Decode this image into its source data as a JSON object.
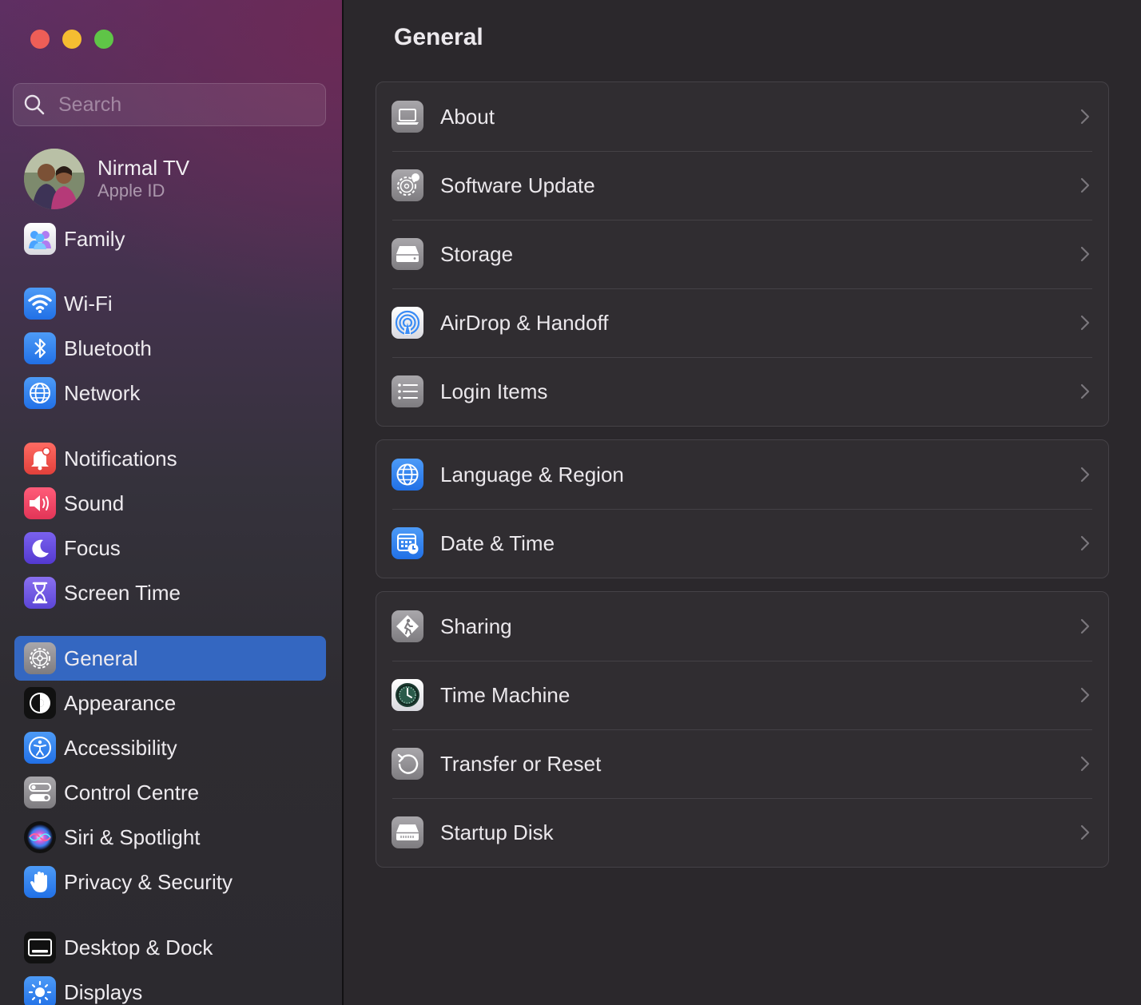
{
  "window": {
    "controls": [
      "close",
      "minimize",
      "zoom"
    ]
  },
  "search": {
    "placeholder": "Search"
  },
  "profile": {
    "name": "Nirmal TV",
    "subtitle": "Apple ID"
  },
  "sidebar": {
    "family": {
      "label": "Family",
      "icon": "family-icon"
    },
    "items": [
      {
        "label": "Wi-Fi",
        "icon": "wifi-icon"
      },
      {
        "label": "Bluetooth",
        "icon": "bluetooth-icon"
      },
      {
        "label": "Network",
        "icon": "globe-icon"
      },
      {
        "label": "Notifications",
        "icon": "bell-icon"
      },
      {
        "label": "Sound",
        "icon": "speaker-icon"
      },
      {
        "label": "Focus",
        "icon": "moon-icon"
      },
      {
        "label": "Screen Time",
        "icon": "hourglass-icon"
      },
      {
        "label": "General",
        "icon": "gear-icon",
        "selected": true
      },
      {
        "label": "Appearance",
        "icon": "appearance-icon"
      },
      {
        "label": "Accessibility",
        "icon": "accessibility-icon"
      },
      {
        "label": "Control Centre",
        "icon": "toggles-icon"
      },
      {
        "label": "Siri & Spotlight",
        "icon": "siri-icon"
      },
      {
        "label": "Privacy & Security",
        "icon": "hand-icon"
      },
      {
        "label": "Desktop & Dock",
        "icon": "dock-icon"
      },
      {
        "label": "Displays",
        "icon": "sun-icon"
      }
    ]
  },
  "main": {
    "title": "General",
    "groups": [
      [
        {
          "label": "About",
          "icon": "laptop-icon"
        },
        {
          "label": "Software Update",
          "icon": "gear-badge-icon"
        },
        {
          "label": "Storage",
          "icon": "drive-icon"
        },
        {
          "label": "AirDrop & Handoff",
          "icon": "airdrop-icon"
        },
        {
          "label": "Login Items",
          "icon": "list-icon"
        }
      ],
      [
        {
          "label": "Language & Region",
          "icon": "globe-icon"
        },
        {
          "label": "Date & Time",
          "icon": "calendar-clock-icon"
        }
      ],
      [
        {
          "label": "Sharing",
          "icon": "sharing-icon"
        },
        {
          "label": "Time Machine",
          "icon": "time-machine-icon"
        },
        {
          "label": "Transfer or Reset",
          "icon": "reset-icon"
        },
        {
          "label": "Startup Disk",
          "icon": "startup-disk-icon"
        }
      ]
    ]
  },
  "colors": {
    "selection": "#3467c1",
    "close": "#ee5e57",
    "minimize": "#f5bd31",
    "zoom": "#5fc547"
  }
}
